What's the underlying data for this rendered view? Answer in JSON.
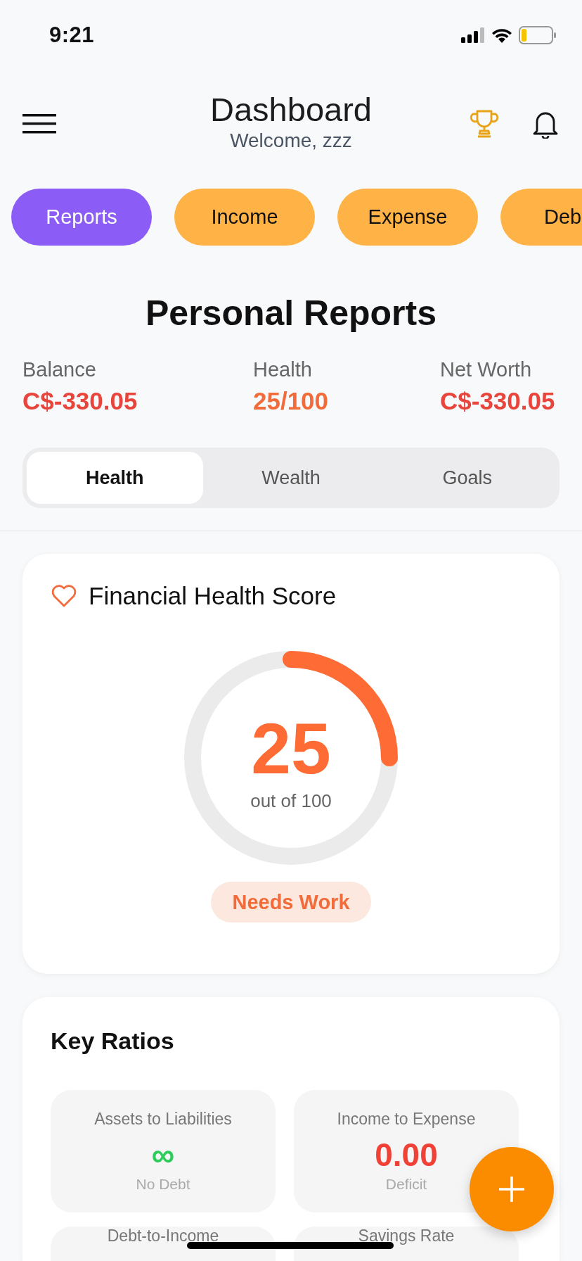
{
  "status_bar": {
    "time": "9:21"
  },
  "header": {
    "title": "Dashboard",
    "subtitle": "Welcome, zzz"
  },
  "chips": [
    {
      "label": "Reports",
      "selected": true
    },
    {
      "label": "Income",
      "selected": false
    },
    {
      "label": "Expense",
      "selected": false
    },
    {
      "label": "Deb",
      "selected": false
    }
  ],
  "page_title": "Personal Reports",
  "stats": [
    {
      "label": "Balance",
      "value": "C$-330.05",
      "color": "#e8453c"
    },
    {
      "label": "Health",
      "value": "25/100",
      "color": "#f26b3a"
    },
    {
      "label": "Net Worth",
      "value": "C$-330.05",
      "color": "#e8453c"
    }
  ],
  "segments": [
    {
      "label": "Health",
      "selected": true
    },
    {
      "label": "Wealth",
      "selected": false
    },
    {
      "label": "Goals",
      "selected": false
    }
  ],
  "health_card": {
    "title": "Financial Health Score",
    "score": "25",
    "caption": "out of 100",
    "level": 0.25,
    "status": "Needs Work"
  },
  "key_ratios": {
    "title": "Key Ratios",
    "items": [
      {
        "label": "Assets to Liabilities",
        "value": "∞",
        "color": "#2ecc5a",
        "note": "No Debt"
      },
      {
        "label": "Income to Expense",
        "value": "0.00",
        "color": "#ef4136",
        "note": "Deficit"
      },
      {
        "label": "Debt-to-Income"
      },
      {
        "label": "Savings Rate"
      }
    ]
  }
}
